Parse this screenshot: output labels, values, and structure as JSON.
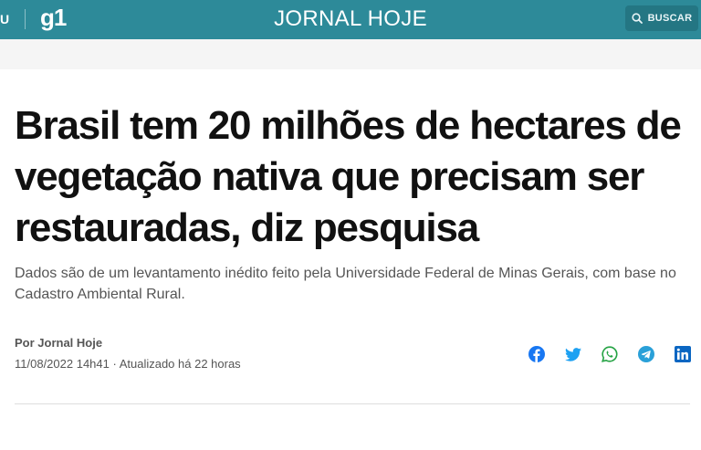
{
  "header": {
    "menu_label": "U",
    "logo": "g1",
    "section_title": "JORNAL HOJE",
    "search_label": "BUSCAR"
  },
  "article": {
    "headline": "Brasil tem 20 milhões de hectares de vegetação nativa que precisam ser restauradas, diz pesquisa",
    "subtitle": "Dados são de um levantamento inédito feito pela Universidade Federal de Minas Gerais, com base no Cadastro Ambiental Rural.",
    "byline": "Por Jornal Hoje",
    "dateline": "11/08/2022 14h41 · Atualizado há 22 horas"
  },
  "share": {
    "icons": [
      "facebook-icon",
      "twitter-icon",
      "whatsapp-icon",
      "telegram-icon",
      "linkedin-icon"
    ]
  },
  "colors": {
    "header_bg": "#2d8a99",
    "share_facebook": "#1877f2",
    "share_twitter": "#1da1f2",
    "share_whatsapp": "#25a344",
    "share_telegram": "#2aa0d8",
    "share_linkedin": "#0a66c2",
    "headline": "#111111",
    "body_text": "#555555"
  }
}
